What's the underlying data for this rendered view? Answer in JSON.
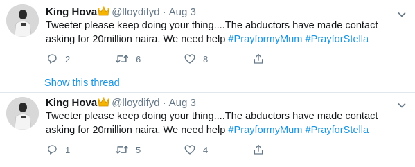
{
  "tweets": [
    {
      "name": "King Hova",
      "badge_icon": "crown-icon",
      "handle": "@lloydifyd",
      "separator": "·",
      "date": "Aug 3",
      "text_before": "Tweeter please keep doing your thing....The abductors have made contact asking for 20million naira. We need help ",
      "hashtag1": "#PrayformyMum",
      "hashtag2": "#PrayforStella",
      "replies": "2",
      "retweets": "6",
      "likes": "8",
      "show_thread": "Show this thread"
    },
    {
      "name": "King Hova",
      "badge_icon": "crown-icon",
      "handle": "@lloydifyd",
      "separator": "·",
      "date": "Aug 3",
      "text_before": "Tweeter please keep doing your thing....The abductors have made contact asking for 20million naira. We need help ",
      "hashtag1": "#PrayformyMum",
      "hashtag2": "#PrayforStella",
      "replies": "1",
      "retweets": "5",
      "likes": "4"
    }
  ],
  "colors": {
    "link": "#1b95e0",
    "muted": "#657786",
    "divider": "#e1e8ed",
    "crown": "#f5b400"
  }
}
